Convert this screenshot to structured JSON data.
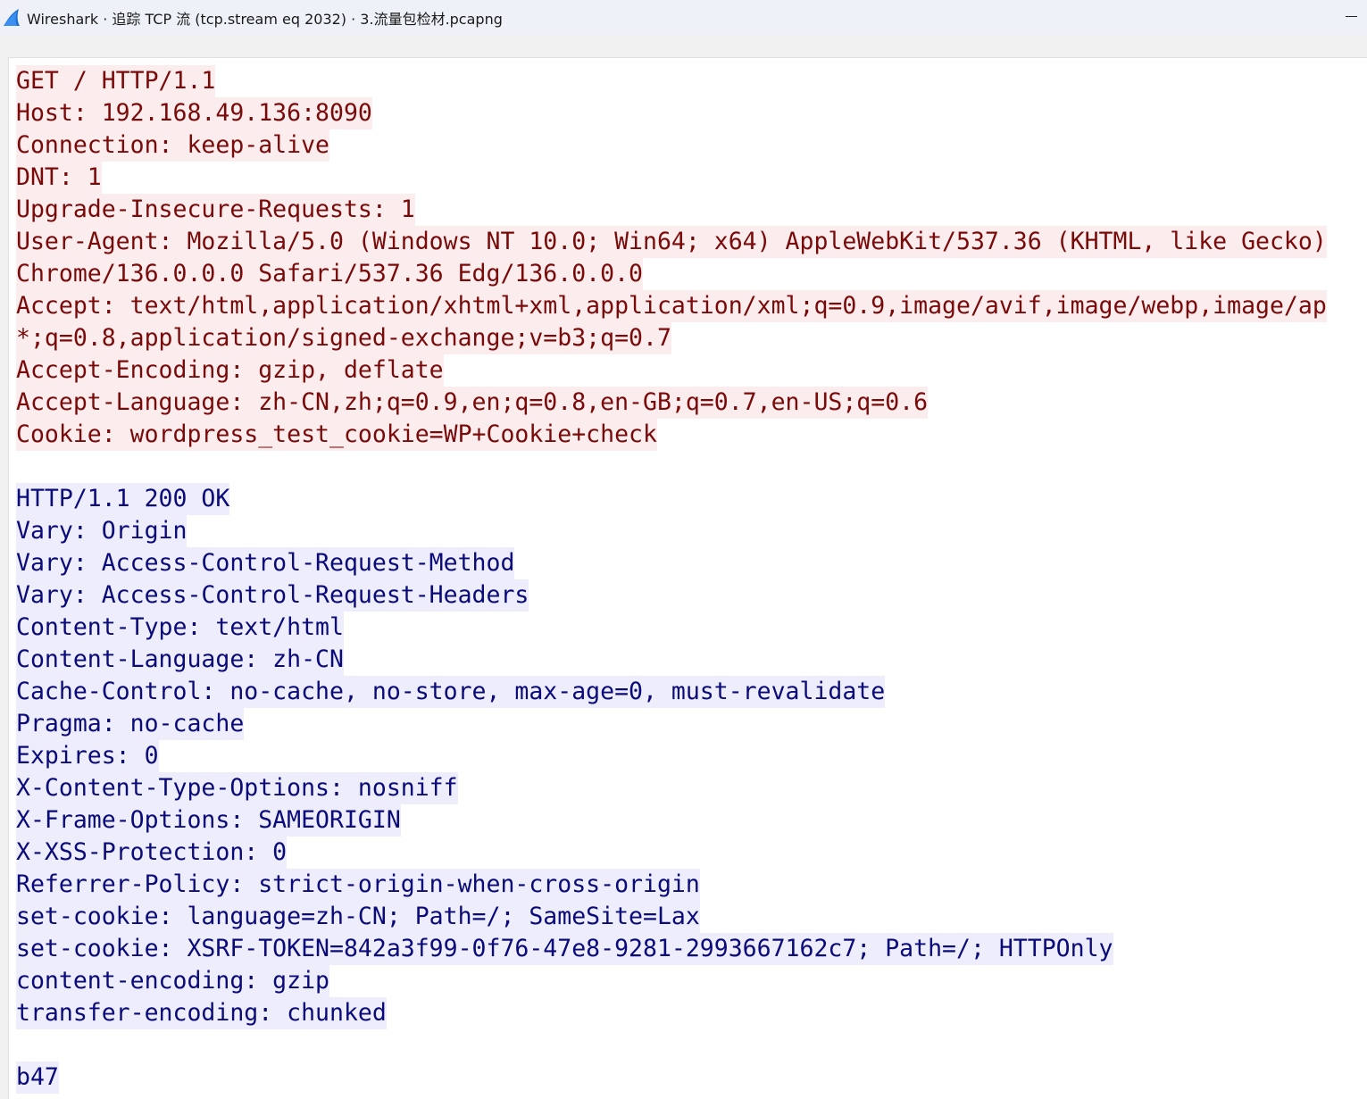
{
  "window": {
    "title": "Wireshark · 追踪 TCP 流 (tcp.stream eq 2032) · 3.流量包检材.pcapng",
    "app_icon": "wireshark-fin-icon",
    "minimize_icon": "minimize-icon"
  },
  "colors": {
    "client_text": "#7a0a0a",
    "client_bg": "#fbeded",
    "server_text": "#0a0a7a",
    "server_bg": "#ededfb"
  },
  "stream": {
    "request_lines": [
      "GET / HTTP/1.1",
      "Host: 192.168.49.136:8090",
      "Connection: keep-alive",
      "DNT: 1",
      "Upgrade-Insecure-Requests: 1",
      "User-Agent: Mozilla/5.0 (Windows NT 10.0; Win64; x64) AppleWebKit/537.36 (KHTML, like Gecko)",
      "Chrome/136.0.0.0 Safari/537.36 Edg/136.0.0.0",
      "Accept: text/html,application/xhtml+xml,application/xml;q=0.9,image/avif,image/webp,image/ap",
      "*;q=0.8,application/signed-exchange;v=b3;q=0.7",
      "Accept-Encoding: gzip, deflate",
      "Accept-Language: zh-CN,zh;q=0.9,en;q=0.8,en-GB;q=0.7,en-US;q=0.6",
      "Cookie: wordpress_test_cookie=WP+Cookie+check"
    ],
    "response_lines": [
      "HTTP/1.1 200 OK",
      "Vary: Origin",
      "Vary: Access-Control-Request-Method",
      "Vary: Access-Control-Request-Headers",
      "Content-Type: text/html",
      "Content-Language: zh-CN",
      "Cache-Control: no-cache, no-store, max-age=0, must-revalidate",
      "Pragma: no-cache",
      "Expires: 0",
      "X-Content-Type-Options: nosniff",
      "X-Frame-Options: SAMEORIGIN",
      "X-XSS-Protection: 0",
      "Referrer-Policy: strict-origin-when-cross-origin",
      "set-cookie: language=zh-CN; Path=/; SameSite=Lax",
      "set-cookie: XSRF-TOKEN=842a3f99-0f76-47e8-9281-2993667162c7; Path=/; HTTPOnly",
      "content-encoding: gzip",
      "transfer-encoding: chunked"
    ],
    "chunk_lines": [
      "b47"
    ]
  }
}
